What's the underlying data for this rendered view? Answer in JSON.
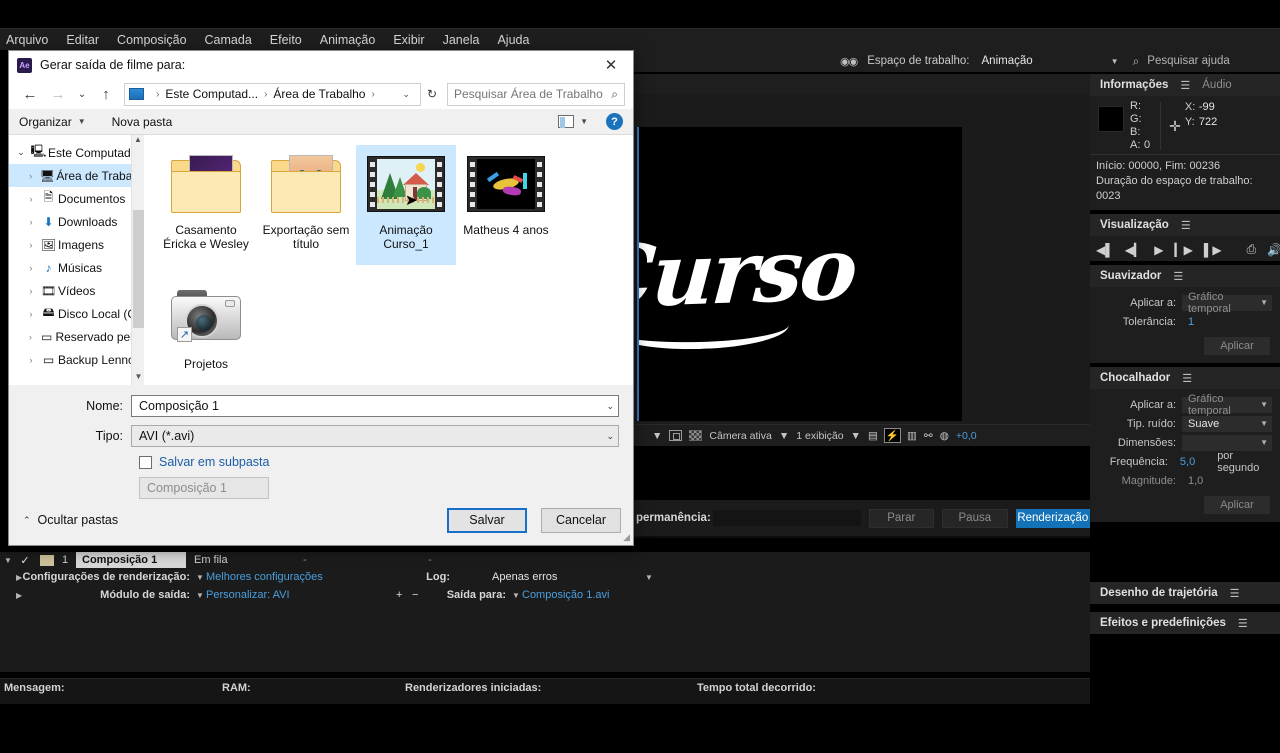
{
  "app": {
    "menu_items": [
      "Arquivo",
      "Editar",
      "Composição",
      "Camada",
      "Efeito",
      "Animação",
      "Exibir",
      "Janela",
      "Ajuda"
    ],
    "workspace_label": "Espaço de trabalho:",
    "workspace_value": "Animação",
    "search_help_placeholder": "Pesquisar ajuda"
  },
  "viewer": {
    "stage_text": "Curso",
    "camera": "Câmera ativa",
    "views": "1 exibição",
    "offset": "+0,0"
  },
  "info_panel": {
    "title": "Informações",
    "tab_audio": "Áudio",
    "r_label": "R:",
    "r_value": "",
    "g_label": "G:",
    "g_value": "",
    "b_label": "B:",
    "b_value": "",
    "a_label": "A:",
    "a_value": "0",
    "x_label": "X:",
    "x_value": "-99",
    "y_label": "Y:",
    "y_value": "722",
    "start_end": "Início: 00000, Fim: 00236",
    "duration": "Duração do espaço de trabalho: 0023"
  },
  "preview_panel": {
    "title": "Visualização"
  },
  "smoother_panel": {
    "title": "Suavizador",
    "apply_to_label": "Aplicar a:",
    "apply_to_value": "Gráfico temporal",
    "tolerance_label": "Tolerância:",
    "tolerance_value": "1",
    "apply_button": "Aplicar"
  },
  "wiggler_panel": {
    "title": "Chocalhador",
    "apply_to_label": "Aplicar a:",
    "apply_to_value": "Gráfico temporal",
    "noise_label": "Tip. ruído:",
    "noise_value": "Suave",
    "dimensions_label": "Dimensões:",
    "dimensions_value": "",
    "frequency_label": "Frequência:",
    "frequency_value": "5,0",
    "frequency_suffix": "por segundo",
    "magnitude_label": "Magnitude:",
    "magnitude_value": "1,0",
    "apply_button": "Aplicar"
  },
  "motion_sketch_panel": {
    "title": "Desenho de trajetória"
  },
  "effects_panel": {
    "title": "Efeitos e predefinições"
  },
  "render_queue": {
    "elapsed_label": "permanência:",
    "stop_button": "Parar",
    "pause_button": "Pausa",
    "render_button": "Renderização",
    "row": {
      "number": "1",
      "comp_name": "Composição 1",
      "status": "Em fila",
      "dash1": "-",
      "dash2": "-"
    },
    "render_settings_label": "Configurações de renderização:",
    "render_settings_value": "Melhores configurações",
    "log_label": "Log:",
    "log_value": "Apenas erros",
    "output_module_label": "Módulo de saída:",
    "output_module_value": "Personalizar: AVI",
    "output_to_label": "Saída para:",
    "output_to_value": "Composição 1.avi"
  },
  "status_bar": {
    "message": "Mensagem:",
    "ram": "RAM:",
    "renderers": "Renderizadores iniciadas:",
    "total_time": "Tempo total decorrido:"
  },
  "dialog": {
    "title": "Gerar saída de filme para:",
    "app_badge": "Ae",
    "close": "✕",
    "breadcrumb": [
      "Este Computad...",
      "Área de Trabalho"
    ],
    "search_placeholder": "Pesquisar Área de Trabalho",
    "toolbar": {
      "organize": "Organizar",
      "new_folder": "Nova pasta"
    },
    "tree": [
      {
        "label": "Este Computador",
        "icon": "computer-icon",
        "expanded": true,
        "selected": false
      },
      {
        "label": "Área de Trabalho",
        "icon": "desktop-icon",
        "expanded": false,
        "selected": true
      },
      {
        "label": "Documentos",
        "icon": "documents-icon",
        "expanded": false,
        "selected": false
      },
      {
        "label": "Downloads",
        "icon": "downloads-icon",
        "expanded": false,
        "selected": false
      },
      {
        "label": "Imagens",
        "icon": "pictures-icon",
        "expanded": false,
        "selected": false
      },
      {
        "label": "Músicas",
        "icon": "music-icon",
        "expanded": false,
        "selected": false
      },
      {
        "label": "Vídeos",
        "icon": "videos-icon",
        "expanded": false,
        "selected": false
      },
      {
        "label": "Disco Local (C:)",
        "icon": "drive-icon",
        "expanded": false,
        "selected": false
      },
      {
        "label": "Reservado pelo S",
        "icon": "drive-icon",
        "expanded": false,
        "selected": false
      },
      {
        "label": "Backup Lennon",
        "icon": "drive-icon",
        "expanded": false,
        "selected": false
      }
    ],
    "files": [
      {
        "name": "Casamento Éricka e Wesley",
        "type": "folder-premiere",
        "selected": false
      },
      {
        "name": "Exportação sem título",
        "type": "folder-face",
        "selected": false
      },
      {
        "name": "Animação Curso_1",
        "type": "video-scene",
        "selected": true
      },
      {
        "name": "Matheus 4 anos",
        "type": "video-abstract",
        "selected": false
      },
      {
        "name": "Projetos",
        "type": "camera-shortcut",
        "selected": false
      }
    ],
    "form": {
      "name_label": "Nome:",
      "name_value": "Composição 1",
      "type_label": "Tipo:",
      "type_value": "AVI (*.avi)",
      "subfolder_label": "Salvar em subpasta",
      "subfolder_checked": false,
      "subfolder_placeholder": "Composição 1"
    },
    "hide_folders": "Ocultar pastas",
    "save_button": "Salvar",
    "cancel_button": "Cancelar"
  }
}
